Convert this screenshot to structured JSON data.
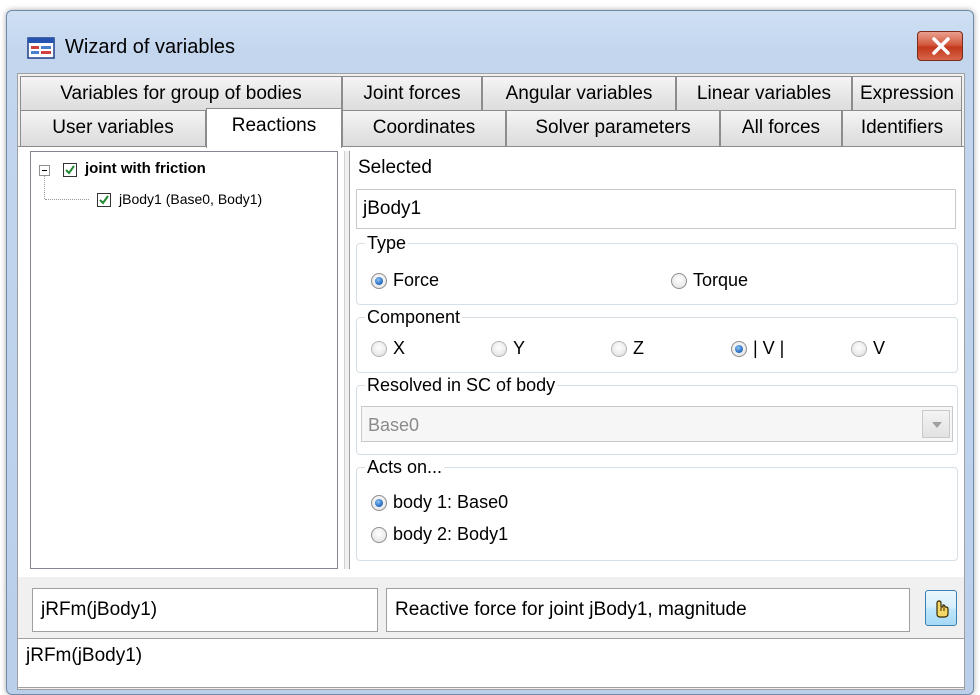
{
  "window": {
    "title": "Wizard of variables",
    "close_glyph": "close-icon"
  },
  "tabs": {
    "row1": [
      {
        "label": "Variables for group of bodies"
      },
      {
        "label": "Joint forces"
      },
      {
        "label": "Angular variables"
      },
      {
        "label": "Linear variables"
      },
      {
        "label": "Expression"
      }
    ],
    "row2": [
      {
        "label": "User variables"
      },
      {
        "label": "Reactions",
        "active": true
      },
      {
        "label": "Coordinates"
      },
      {
        "label": "Solver parameters"
      },
      {
        "label": "All forces"
      },
      {
        "label": "Identifiers"
      }
    ]
  },
  "tree": {
    "items": [
      {
        "label": "joint with friction",
        "checked": true,
        "expanded": true
      },
      {
        "label": "jBody1 (Base0, Body1)",
        "checked": true
      }
    ]
  },
  "selected": {
    "label": "Selected",
    "value": "jBody1"
  },
  "type_group": {
    "legend": "Type",
    "options": [
      {
        "label": "Force",
        "checked": true
      },
      {
        "label": "Torque",
        "checked": false
      }
    ]
  },
  "component_group": {
    "legend": "Component",
    "options": [
      {
        "label": "X",
        "checked": false
      },
      {
        "label": "Y",
        "checked": false
      },
      {
        "label": "Z",
        "checked": false
      },
      {
        "label": "| V |",
        "checked": true
      },
      {
        "label": "V",
        "checked": false
      }
    ]
  },
  "resolved_group": {
    "legend": "Resolved in SC of body",
    "value": "Base0",
    "enabled": false
  },
  "acts_group": {
    "legend": "Acts on...",
    "options": [
      {
        "label": "body 1: Base0",
        "checked": true
      },
      {
        "label": "body 2: Body1",
        "checked": false
      }
    ]
  },
  "footer": {
    "identifier": "jRFm(jBody1)",
    "description": "Reactive force for joint jBody1, magnitude",
    "pick_icon": "pointing-hand-icon",
    "expression": "jRFm(jBody1)"
  },
  "colors": {
    "title_bar": "#c3d6ee",
    "close_button": "#c2381d",
    "radio_checked": "#2b73c9"
  }
}
